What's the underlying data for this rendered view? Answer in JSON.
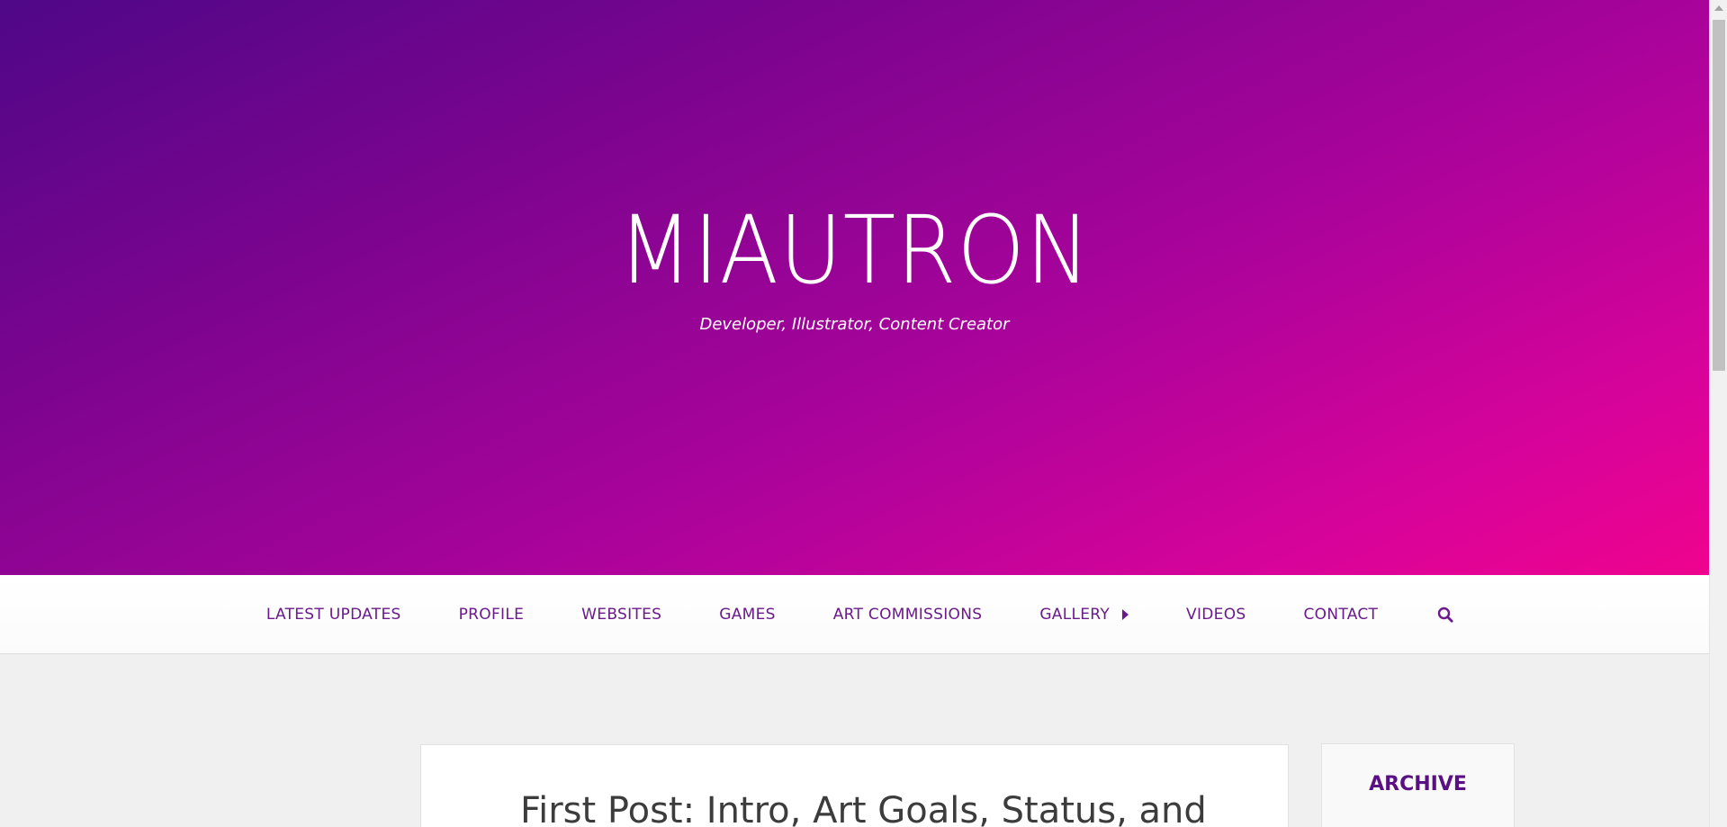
{
  "header": {
    "site_title": "MIAUTRON",
    "tagline": "Developer, Illustrator, Content Creator"
  },
  "nav": {
    "items": [
      {
        "label": "LATEST UPDATES"
      },
      {
        "label": "PROFILE"
      },
      {
        "label": "WEBSITES"
      },
      {
        "label": "GAMES"
      },
      {
        "label": "ART COMMISSIONS"
      },
      {
        "label": "GALLERY",
        "has_submenu": true
      },
      {
        "label": "VIDEOS"
      },
      {
        "label": "CONTACT"
      }
    ],
    "search_icon": "search-icon"
  },
  "main": {
    "post_title": "First Post: Intro, Art Goals, Status, and"
  },
  "sidebar": {
    "archive_title": "ARCHIVE"
  },
  "colors": {
    "gradient_start": "#4f0788",
    "gradient_end": "#ef038e",
    "nav_text": "#6a1a8a",
    "page_bg": "#f0f0f1",
    "sidebar_title": "#5a0f82"
  }
}
